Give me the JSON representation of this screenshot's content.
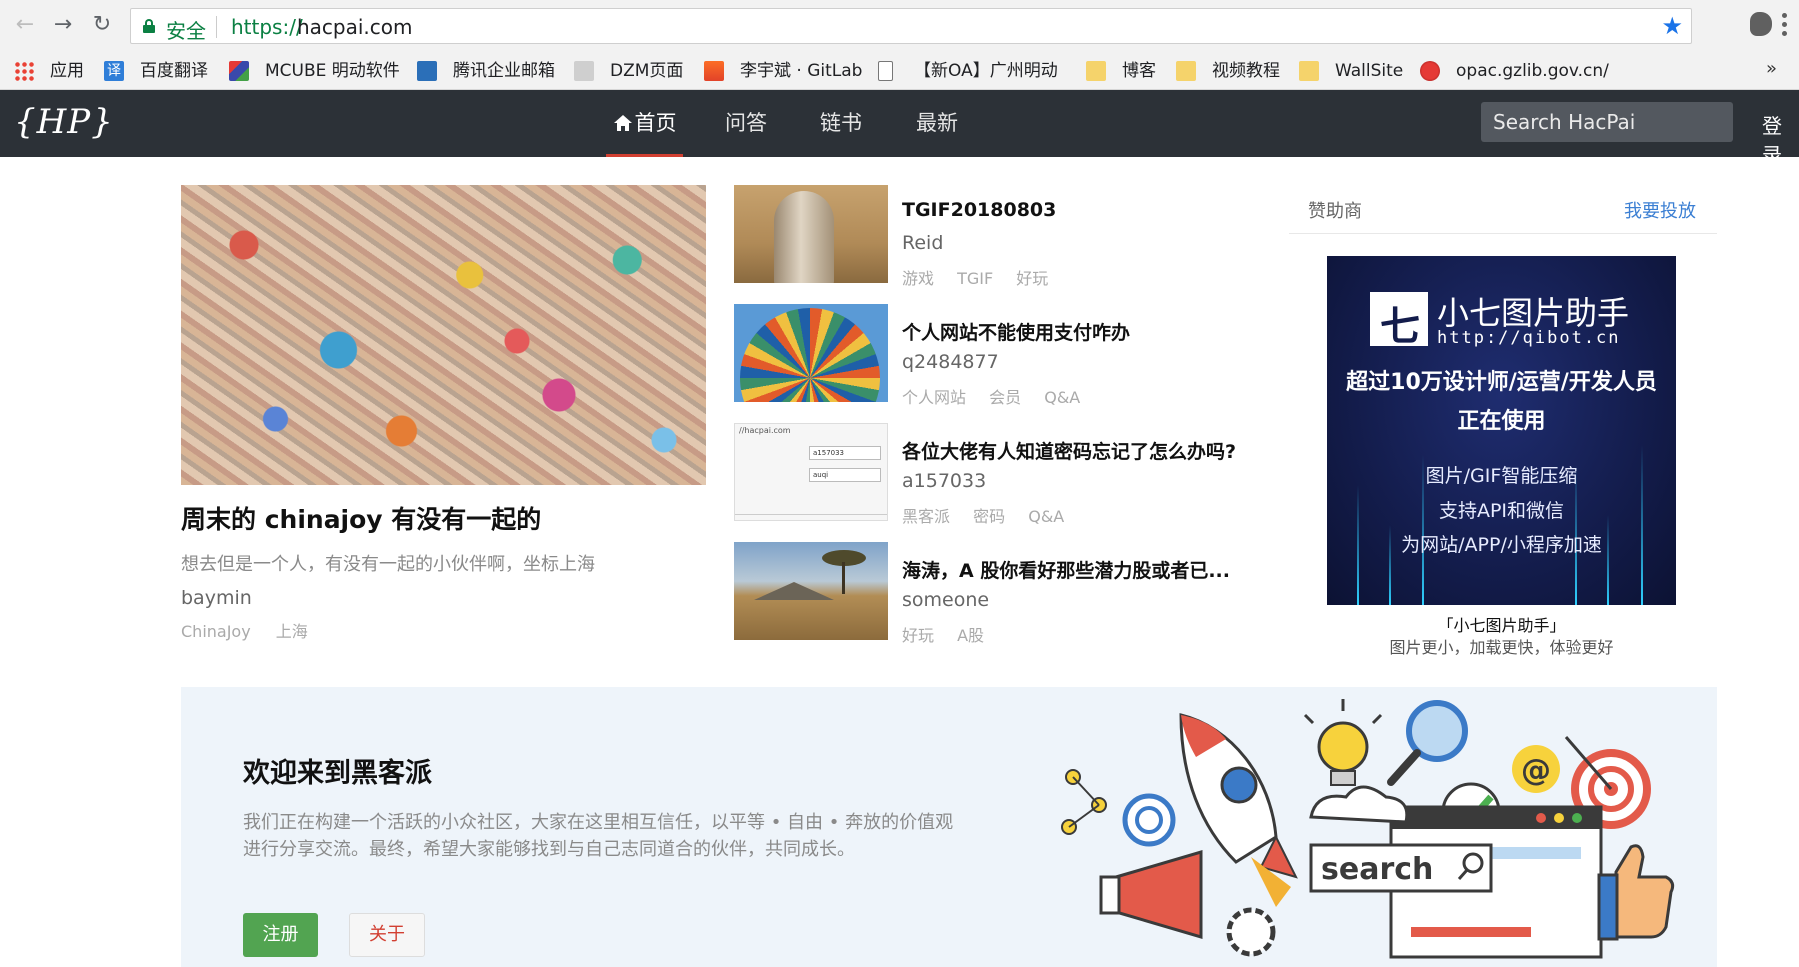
{
  "browser": {
    "secure_label": "安全",
    "url_scheme": "https://",
    "url_host": "hacpai.com",
    "bookmarks": [
      {
        "label": "应用",
        "color": "#e94235"
      },
      {
        "label": "百度翻译",
        "color": "#2f7ed8"
      },
      {
        "label": "MCUBE 明动软件",
        "color": "#5a5adb"
      },
      {
        "label": "腾讯企业邮箱",
        "color": "#2b6fb8"
      },
      {
        "label": "DZM页面",
        "color": "#999999"
      },
      {
        "label": "李宇斌 · GitLab",
        "color": "#e24329"
      },
      {
        "label": "【新OA】广州明动",
        "color": "#eeeeee"
      },
      {
        "label": "博客",
        "color": "#f5d36b"
      },
      {
        "label": "视频教程",
        "color": "#f5d36b"
      },
      {
        "label": "WallSite",
        "color": "#f5d36b"
      },
      {
        "label": "opac.gzlib.gov.cn/",
        "color": "#c62828"
      }
    ],
    "more": "»"
  },
  "header": {
    "logo": "{HP}",
    "nav": [
      "首页",
      "问答",
      "链书",
      "最新"
    ],
    "search_placeholder": "Search HacPai",
    "login": "登录"
  },
  "feature": {
    "title": "周末的 chinajoy 有没有一起的",
    "desc": "想去但是一个人，有没有一起的小伙伴啊，坐标上海",
    "author": "baymin",
    "tags": [
      "ChinaJoy",
      "上海"
    ]
  },
  "articles": [
    {
      "title": "TGIF20180803",
      "author": "Reid",
      "tags": [
        "游戏",
        "TGIF",
        "好玩"
      ]
    },
    {
      "title": "个人网站不能使用支付咋办",
      "author": "q2484877",
      "tags": [
        "个人网站",
        "会员",
        "Q&A"
      ]
    },
    {
      "title": "各位大佬有人知道密码忘记了怎么办吗?",
      "author": "a157033",
      "tags": [
        "黑客派",
        "密码",
        "Q&A"
      ]
    },
    {
      "title": "海涛，A 股你看好那些潜力股或者已...",
      "author": "someone",
      "tags": [
        "好玩",
        "A股"
      ]
    }
  ],
  "thumb3": {
    "site": "//hacpai.com",
    "field1": "a157033",
    "field2": "auqi"
  },
  "sponsor": {
    "label": "赞助商",
    "link": "我要投放",
    "ad": {
      "brand": "小七图片助手",
      "url": "http://qibot.cn",
      "line1": "超过10万设计师/运营/开发人员",
      "line2": "正在使用",
      "features": [
        "图片/GIF智能压缩",
        "支持API和微信",
        "为网站/APP/小程序加速"
      ]
    },
    "caption_title": "「小七图片助手」",
    "caption_sub": "图片更小，加载更快，体验更好"
  },
  "welcome": {
    "title": "欢迎来到黑客派",
    "text": "我们正在构建一个活跃的小众社区，大家在这里相互信任，以平等 • 自由 • 奔放的价值观进行分享交流。最终，希望大家能够找到与自己志同道合的伙伴，共同成长。",
    "register": "注册",
    "about": "关于",
    "illustration_word": "search"
  }
}
